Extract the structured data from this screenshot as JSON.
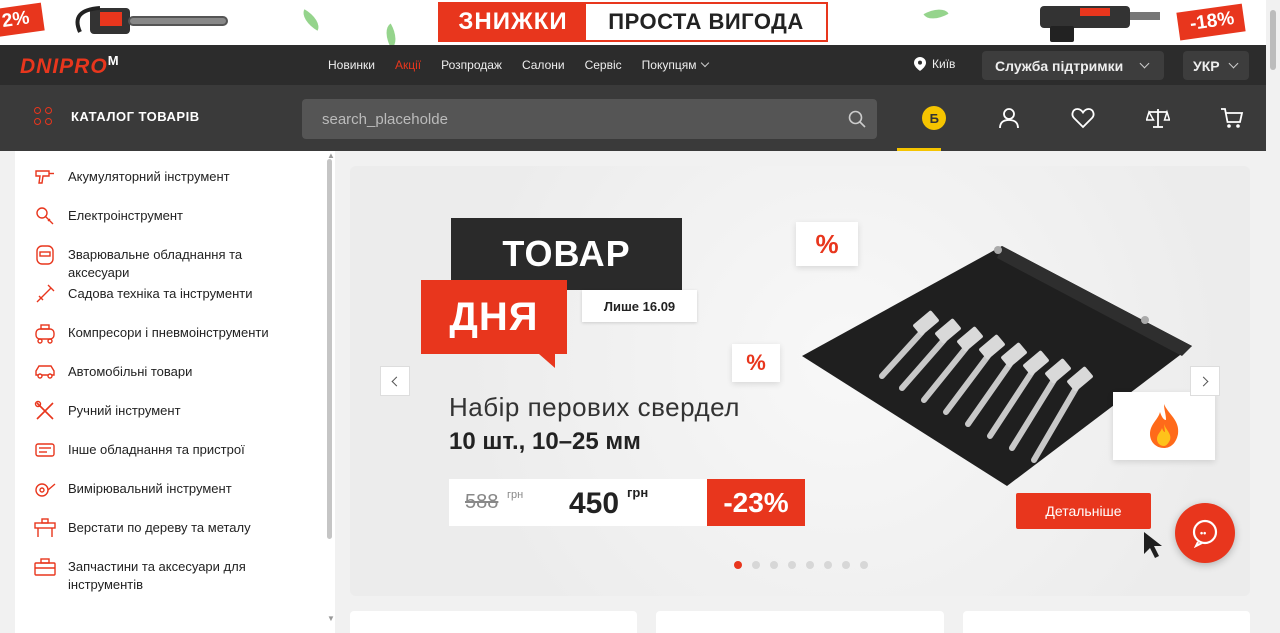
{
  "promo": {
    "left_badge": "2%",
    "right_badge": "-18%",
    "box_left": "ЗНИЖКИ",
    "box_right": "ПРОСТА ВИГОДА"
  },
  "brand": {
    "name": "DNIPRO",
    "suffix": "M"
  },
  "topnav": {
    "links": [
      "Новинки",
      "Акції",
      "Розпродаж",
      "Салони",
      "Сервіс",
      "Покупцям"
    ],
    "active_index": 1,
    "city": "Київ",
    "support": "Служба підтримки",
    "language": "УКР"
  },
  "header": {
    "catalog_label": "КАТАЛОГ ТОВАРІВ",
    "search_placeholder": "search_placeholde",
    "bonus_letter": "Б",
    "icons": [
      "bonus-icon",
      "user-icon",
      "heart-icon",
      "compare-icon",
      "cart-icon"
    ]
  },
  "sidebar": {
    "items": [
      {
        "label": "Акумуляторний інструмент",
        "icon": "cordless-drill-icon"
      },
      {
        "label": "Електроінструмент",
        "icon": "power-tool-icon"
      },
      {
        "label": "Зварювальне обладнання та аксесуари",
        "icon": "welding-mask-icon"
      },
      {
        "label": "Садова техніка та інструменти",
        "icon": "garden-tool-icon"
      },
      {
        "label": "Компресори і пневмоінструменти",
        "icon": "compressor-icon"
      },
      {
        "label": "Автомобільні товари",
        "icon": "car-icon"
      },
      {
        "label": "Ручний інструмент",
        "icon": "hand-tools-icon"
      },
      {
        "label": "Інше обладнання та пристрої",
        "icon": "equipment-icon"
      },
      {
        "label": "Вимірювальний інструмент",
        "icon": "measuring-icon"
      },
      {
        "label": "Верстати по дереву та металу",
        "icon": "workbench-icon"
      },
      {
        "label": "Запчастини та аксесуари для інструментів",
        "icon": "toolbox-icon"
      }
    ]
  },
  "hero": {
    "tag_top": "ТОВАР",
    "tag_bottom": "ДНЯ",
    "only_until": "Лише 16.09",
    "percent_sign": "%",
    "product_line1": "Набір перових свердел",
    "product_line2": "10 шт., 10–25 мм",
    "old_price": "588",
    "new_price": "450",
    "currency": "грн",
    "discount": "-23%",
    "details_button": "Детальніше",
    "slide_count": 8,
    "active_slide": 0
  },
  "colors": {
    "accent": "#e8361d",
    "dark": "#2c2c2c",
    "bonus": "#f5c400"
  }
}
